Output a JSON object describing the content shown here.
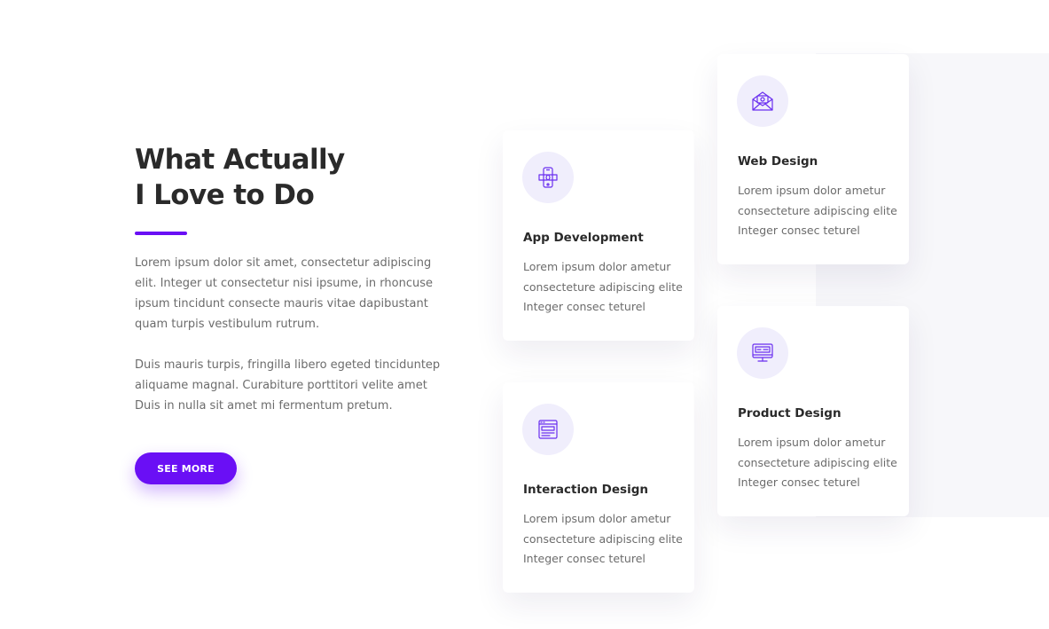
{
  "intro": {
    "title_line1": "What Actually",
    "title_line2": "I Love to Do",
    "paragraph1": "Lorem ipsum dolor sit amet, consectetur adipiscing elit. Integer ut consectetur nisi ipsume, in rhoncuse ipsum tincidunt consecte mauris vitae dapibustant quam turpis vestibulum rutrum.",
    "paragraph2": "Duis mauris turpis, fringilla libero egeted tinciduntер aliquame magnal. Curabiture porttitori velite amet Duis in nulla sit amet mi fermentum pretum.",
    "button_label": "SEE MORE",
    "accent_color": "#6a0ff5"
  },
  "services": [
    {
      "icon": "app-development-icon",
      "title": "App Development",
      "text": "Lorem ipsum dolor ametur consecteture adipiscing elite Integer consec teturel"
    },
    {
      "icon": "interaction-design-icon",
      "title": "Interaction Design",
      "text": "Lorem ipsum dolor ametur consecteture adipiscing elite Integer consec teturel"
    },
    {
      "icon": "web-design-icon",
      "title": "Web Design",
      "text": "Lorem ipsum dolor ametur consecteture adipiscing elite Integer consec teturel"
    },
    {
      "icon": "product-design-icon",
      "title": "Product Design",
      "text": "Lorem ipsum dolor ametur consecteture adipiscing elite Integer consec teturel"
    }
  ]
}
